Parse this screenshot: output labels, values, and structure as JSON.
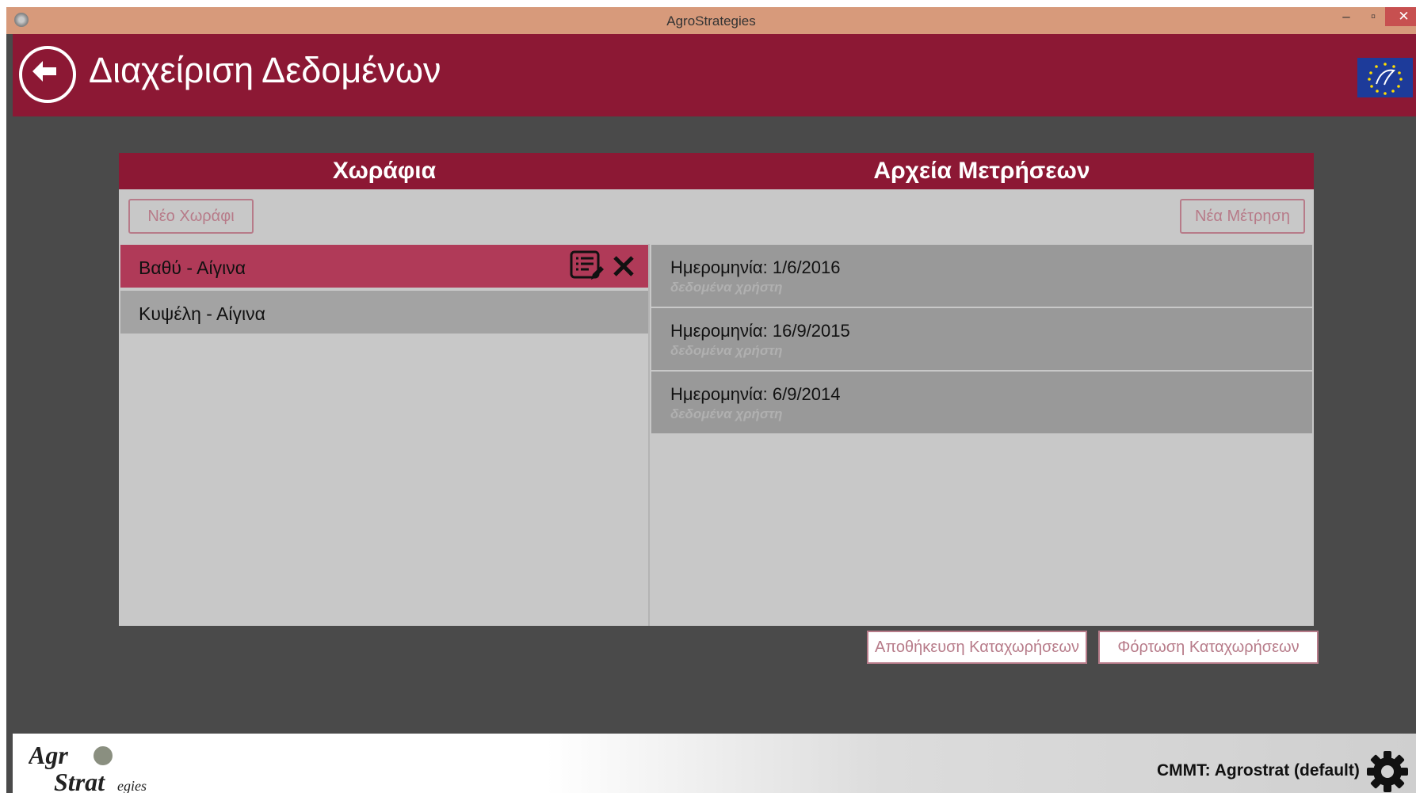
{
  "window": {
    "title": "AgroStrategies",
    "minimize": "–",
    "maximize": "▫",
    "close": "✕"
  },
  "header": {
    "title": "Διαχείριση Δεδομένων"
  },
  "fields_panel": {
    "title": "Χωράφια",
    "new_button": "Νέο Χωράφι",
    "items": [
      {
        "label": "Βαθύ - Αίγινα",
        "selected": true
      },
      {
        "label": "Κυψέλη - Αίγινα",
        "selected": false
      }
    ]
  },
  "measurements_panel": {
    "title": "Αρχεία Μετρήσεων",
    "new_button": "Νέα Μέτρηση",
    "items": [
      {
        "date": "Ημερομηνία: 1/6/2016",
        "source": "δεδομένα χρήστη"
      },
      {
        "date": "Ημερομηνία: 16/9/2015",
        "source": "δεδομένα χρήστη"
      },
      {
        "date": "Ημερομηνία: 6/9/2014",
        "source": "δεδομένα χρήστη"
      }
    ]
  },
  "actions": {
    "save": "Αποθήκευση Καταχωρήσεων",
    "load": "Φόρτωση Καταχωρήσεων"
  },
  "footer": {
    "status": "CMMT: Agrostrat (default)"
  },
  "colors": {
    "header": "#8c1834",
    "selected_item": "#b03a58",
    "accent_outline": "#b77b89",
    "titlebar": "#d79a7b"
  }
}
